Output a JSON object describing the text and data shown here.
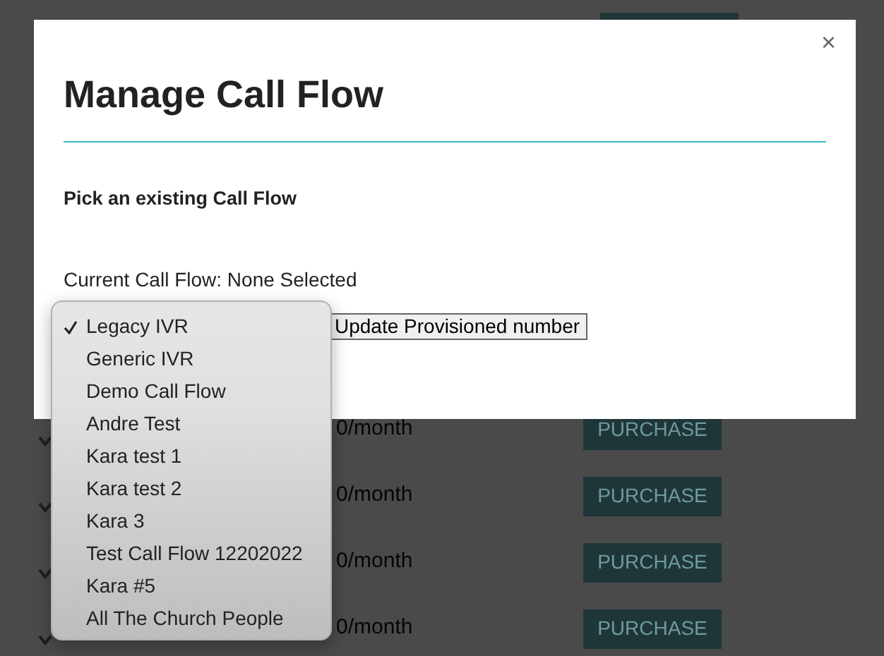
{
  "background_rows": [
    {
      "price": "0/month",
      "button": "PURCHASE"
    },
    {
      "price": "0/month",
      "button": "PURCHASE"
    },
    {
      "price": "0/month",
      "button": "PURCHASE"
    },
    {
      "price": "0/month",
      "button": "PURCHASE"
    }
  ],
  "modal": {
    "close": "×",
    "title": "Manage Call Flow",
    "subtitle": "Pick an existing Call Flow",
    "current": "Current Call Flow: None Selected",
    "update_button": "Update Provisioned number"
  },
  "dropdown": {
    "options": [
      {
        "label": "Legacy IVR",
        "selected": true
      },
      {
        "label": "Generic IVR",
        "selected": false
      },
      {
        "label": "Demo Call Flow",
        "selected": false
      },
      {
        "label": "Andre Test",
        "selected": false
      },
      {
        "label": "Kara test 1",
        "selected": false
      },
      {
        "label": "Kara test 2",
        "selected": false
      },
      {
        "label": "Kara 3",
        "selected": false
      },
      {
        "label": "Test Call Flow 12202022",
        "selected": false
      },
      {
        "label": "Kara #5",
        "selected": false
      },
      {
        "label": "All The Church People",
        "selected": false
      }
    ]
  }
}
